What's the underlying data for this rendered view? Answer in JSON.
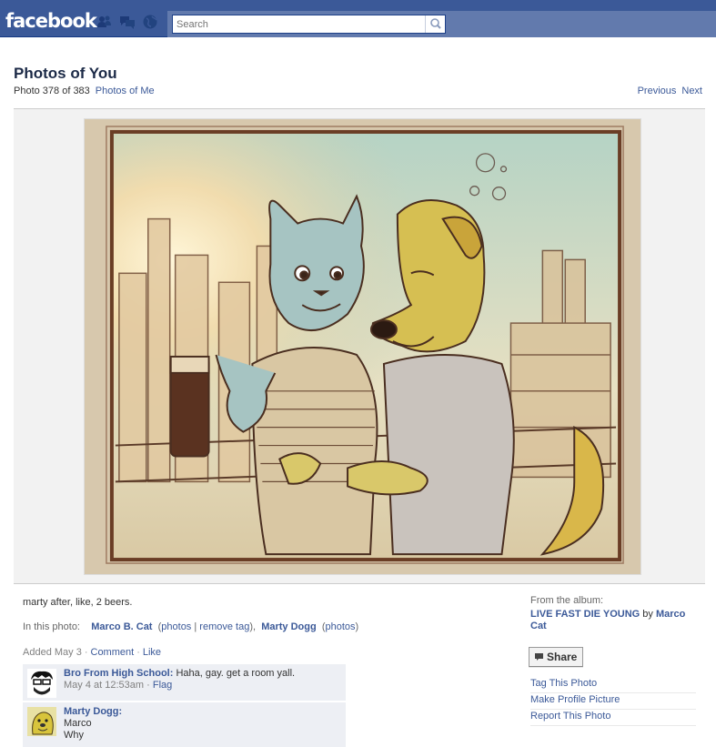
{
  "topbar": {
    "logo": "facebook",
    "search": {
      "placeholder": "Search",
      "value": "Search"
    },
    "icons": [
      "friends-requests-icon",
      "messages-icon",
      "notifications-globe-icon",
      "search-icon"
    ]
  },
  "header": {
    "title": "Photos of You",
    "photo_position": "Photo 378 of 383",
    "photos_of_me_link": "Photos of Me",
    "previous": "Previous",
    "next": "Next"
  },
  "photo": {
    "description": "sketch-illustration"
  },
  "caption": "marty after, like, 2 beers.",
  "in_this_photo": {
    "label": "In this photo:",
    "tag1_name": "Marco B. Cat",
    "tag1_open": "(",
    "tag1_photos": "photos",
    "tag1_sep": " | ",
    "tag1_remove": "remove tag",
    "tag1_close": "),",
    "tag2_name": "Marty Dogg",
    "tag2_open": "(",
    "tag2_photos": "photos",
    "tag2_close": ")"
  },
  "added": {
    "text": "Added May 3",
    "dot1": "·",
    "comment": "Comment",
    "dot2": "·",
    "like": "Like"
  },
  "comments": [
    {
      "author": "Bro From High School:",
      "text": " Haha, gay. get a room yall.",
      "time": "May 4 at 12:53am",
      "dot": " · ",
      "flag": "Flag"
    },
    {
      "author": "Marty Dogg:",
      "line1": "Marco",
      "line2": "Why"
    }
  ],
  "album": {
    "label": "From the album:",
    "name": "LIVE FAST DIE YOUNG",
    "by": " by ",
    "owner": "Marco Cat"
  },
  "actions": {
    "share": "Share",
    "tag": "Tag This Photo",
    "profile": "Make Profile Picture",
    "report": "Report This Photo"
  },
  "colors": {
    "brand": "#3b5998",
    "topbar_secondary": "#627aad",
    "comment_bg": "#edeff4",
    "stage_bg": "#f2f2f2"
  }
}
